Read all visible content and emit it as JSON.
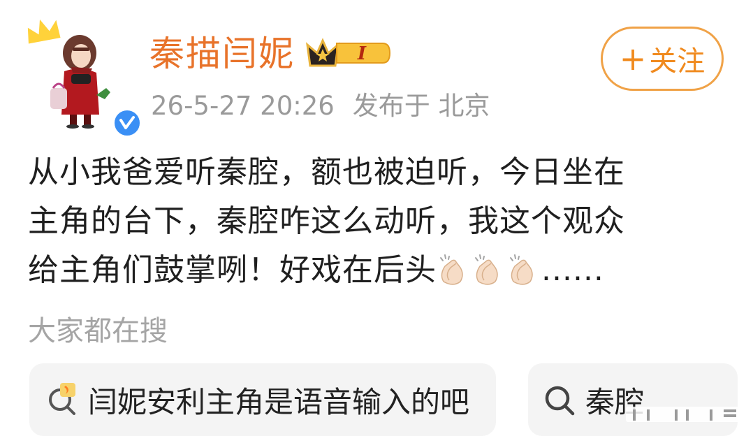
{
  "post": {
    "user": {
      "name": "秦描闫妮",
      "vip_level": "I",
      "verified": true
    },
    "timestamp": "26-5-27 20:26",
    "location": "发布于 北京",
    "follow_plus": "+",
    "follow_label": "关注",
    "content_lines": [
      "从小我爸爱听秦腔，额也被迫听，今日坐在",
      "主角的台下，秦腔咋这么动听，我这个观众",
      "给主角们鼓掌咧！好戏在后头"
    ],
    "content_trailing": "......",
    "emoji": "clapping-hands"
  },
  "trending": {
    "title": "大家都在搜",
    "items": [
      {
        "icon": "hot-search-icon",
        "label": "闫妮安利主角是语音输入的吧"
      },
      {
        "icon": "search-icon",
        "label": "秦腔"
      }
    ]
  },
  "colors": {
    "username": "#e8732a",
    "follow": "#f08a1e",
    "verified": "#3a8ff5",
    "meta": "#9a9a9a"
  }
}
